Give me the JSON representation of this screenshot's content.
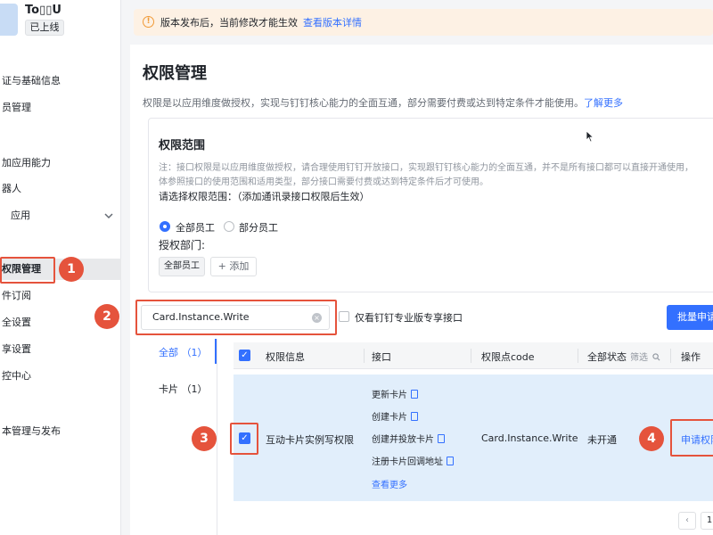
{
  "app": {
    "name": "To▯▯U",
    "status": "已上线"
  },
  "sidebar": {
    "items": [
      {
        "label": "证与基础信息"
      },
      {
        "label": "员管理"
      },
      {
        "label": "加应用能力"
      },
      {
        "label": "器人"
      },
      {
        "label": "应用"
      },
      {
        "label": "权限管理"
      },
      {
        "label": "件订阅"
      },
      {
        "label": "全设置"
      },
      {
        "label": "享设置"
      },
      {
        "label": "控中心"
      },
      {
        "label": "本管理与发布"
      }
    ]
  },
  "banner": {
    "text": "版本发布后，当前修改才能生效",
    "link": "查看版本详情"
  },
  "page": {
    "title": "权限管理",
    "desc": "权限是以应用维度做授权，实现与钉钉核心能力的全面互通，部分需要付费或达到特定条件才能使用。",
    "desc_link": "了解更多"
  },
  "scope": {
    "title": "权限范围",
    "note1": "注：接口权限是以应用维度做授权，请合理使用钉钉开放接口，实现跟钉钉核心能力的全面互通，并不是所有接口都可以直接开通使用，",
    "note2": "体参照接口的使用范围和适用类型，部分接口需要付费或达到特定条件后才可使用。",
    "choose": "请选择权限范围：（添加通讯录接口权限后生效）",
    "radio_all": "全部员工",
    "radio_part": "部分员工",
    "dept_label": "授权部门:",
    "dept_tag": "全部员工",
    "add_label": "+ 添加"
  },
  "search": {
    "value": "Card.Instance.Write",
    "pro_only": "仅看钉钉专业版专享接口",
    "batch": "批量申请"
  },
  "categories": [
    {
      "label": "全部 （1）"
    },
    {
      "label": "卡片 （1）"
    }
  ],
  "table": {
    "headers": {
      "info": "权限信息",
      "iface": "接口",
      "code": "权限点code",
      "status": "全部状态",
      "filter": "筛选",
      "action": "操作"
    },
    "row": {
      "info": "互动卡片实例写权限",
      "interfaces": [
        "更新卡片",
        "创建卡片",
        "创建并投放卡片",
        "注册卡片回调地址"
      ],
      "more": "查看更多",
      "code": "Card.Instance.Write",
      "status": "未开通",
      "action": "申请权限"
    }
  },
  "pagination": {
    "current": "1"
  },
  "annotations": [
    "1",
    "2",
    "3",
    "4"
  ]
}
